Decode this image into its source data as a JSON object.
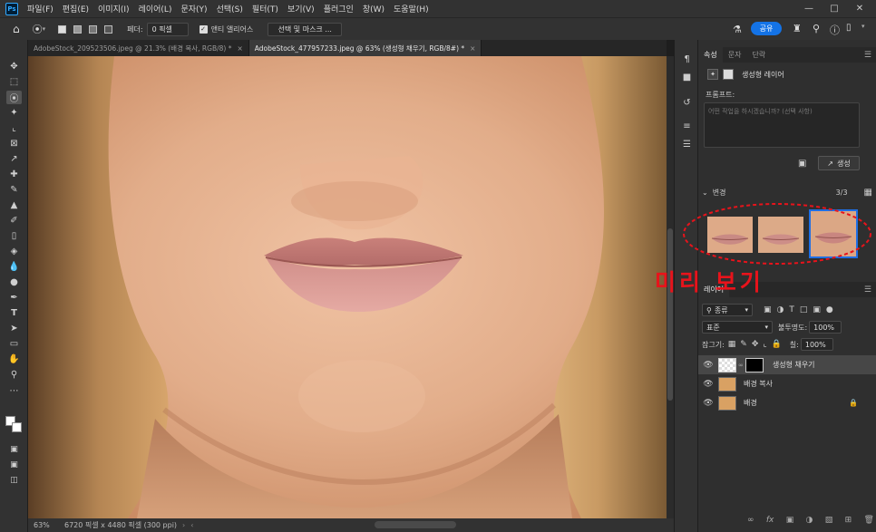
{
  "app": {
    "logo": "Ps"
  },
  "menu": [
    "파일(F)",
    "편집(E)",
    "이미지(I)",
    "레이어(L)",
    "문자(Y)",
    "선택(S)",
    "필터(T)",
    "보기(V)",
    "플러그인",
    "창(W)",
    "도움말(H)"
  ],
  "window_controls": [
    "minimize-icon",
    "maximize-icon",
    "close-icon"
  ],
  "options": {
    "feather_label": "페더:",
    "feather_value": "0 픽셀",
    "antialias_label": "앤티 앨리어스",
    "select_mask_label": "선택 및 마스크 ...",
    "share_label": "공유"
  },
  "tabs": [
    {
      "title": "AdobeStock_209523506.jpeg @ 21.3% (배경 복사, RGB/8) *"
    },
    {
      "title": "AdobeStock_477957233.jpeg @ 63% (생성형 채우기, RGB/8#) *"
    }
  ],
  "status": {
    "zoom": "63%",
    "doc_info": "6720 픽셀 x 4480 픽셀 (300 ppi)"
  },
  "properties": {
    "tabs": [
      "속성",
      "문자",
      "단락"
    ],
    "layer_type": "생성형 레이어",
    "prompt_label": "프롬프트:",
    "prompt_placeholder": "어떤 작업을 하시겠습니까? (선택 사항)",
    "generate_label": "생성",
    "variations_label": "변경",
    "variations_count": "3/3"
  },
  "annotation": {
    "text": "미리 보기",
    "color": "#e8131b"
  },
  "layers": {
    "title": "레이어",
    "filter_label": "종류",
    "blend_mode": "표준",
    "opacity_label": "불투명도:",
    "opacity_value": "100%",
    "lock_label": "잠그기:",
    "fill_label": "칠:",
    "fill_value": "100%",
    "items": [
      {
        "name": "생성형 채우기",
        "selected": true
      },
      {
        "name": "배경 복사",
        "selected": false
      },
      {
        "name": "배경",
        "selected": false,
        "locked": true
      }
    ]
  },
  "colors": {
    "accent": "#1473e6",
    "annotation": "#e8131b",
    "selection": "#1f6fe5"
  }
}
